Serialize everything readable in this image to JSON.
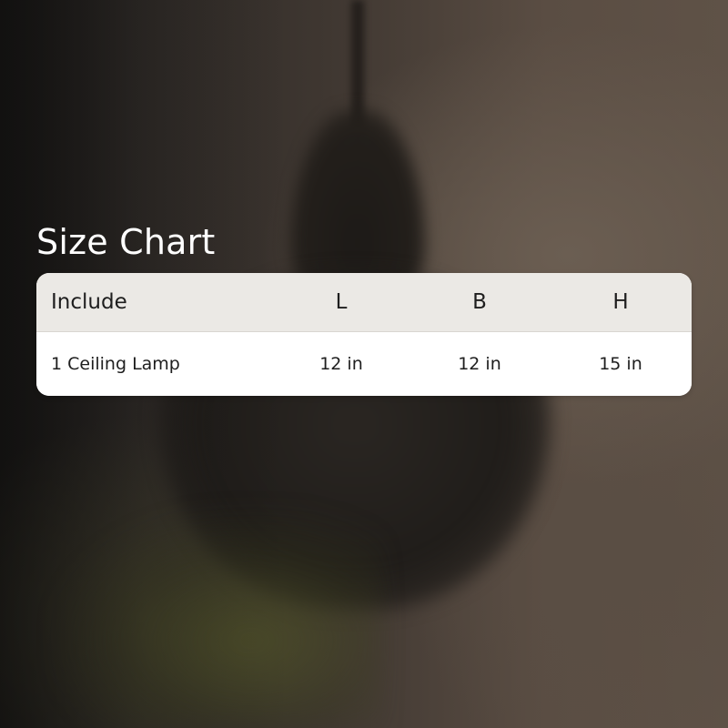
{
  "title": "Size Chart",
  "table": {
    "headers": [
      "Include",
      "L",
      "B",
      "H"
    ],
    "rows": [
      [
        "1 Ceiling Lamp",
        "12 in",
        "12 in",
        "15 in"
      ]
    ]
  },
  "colors": {
    "header_background": "#ebe9e5",
    "row_background": "#ffffff",
    "title_text": "#ffffff",
    "table_text": "#1e1e1e"
  }
}
